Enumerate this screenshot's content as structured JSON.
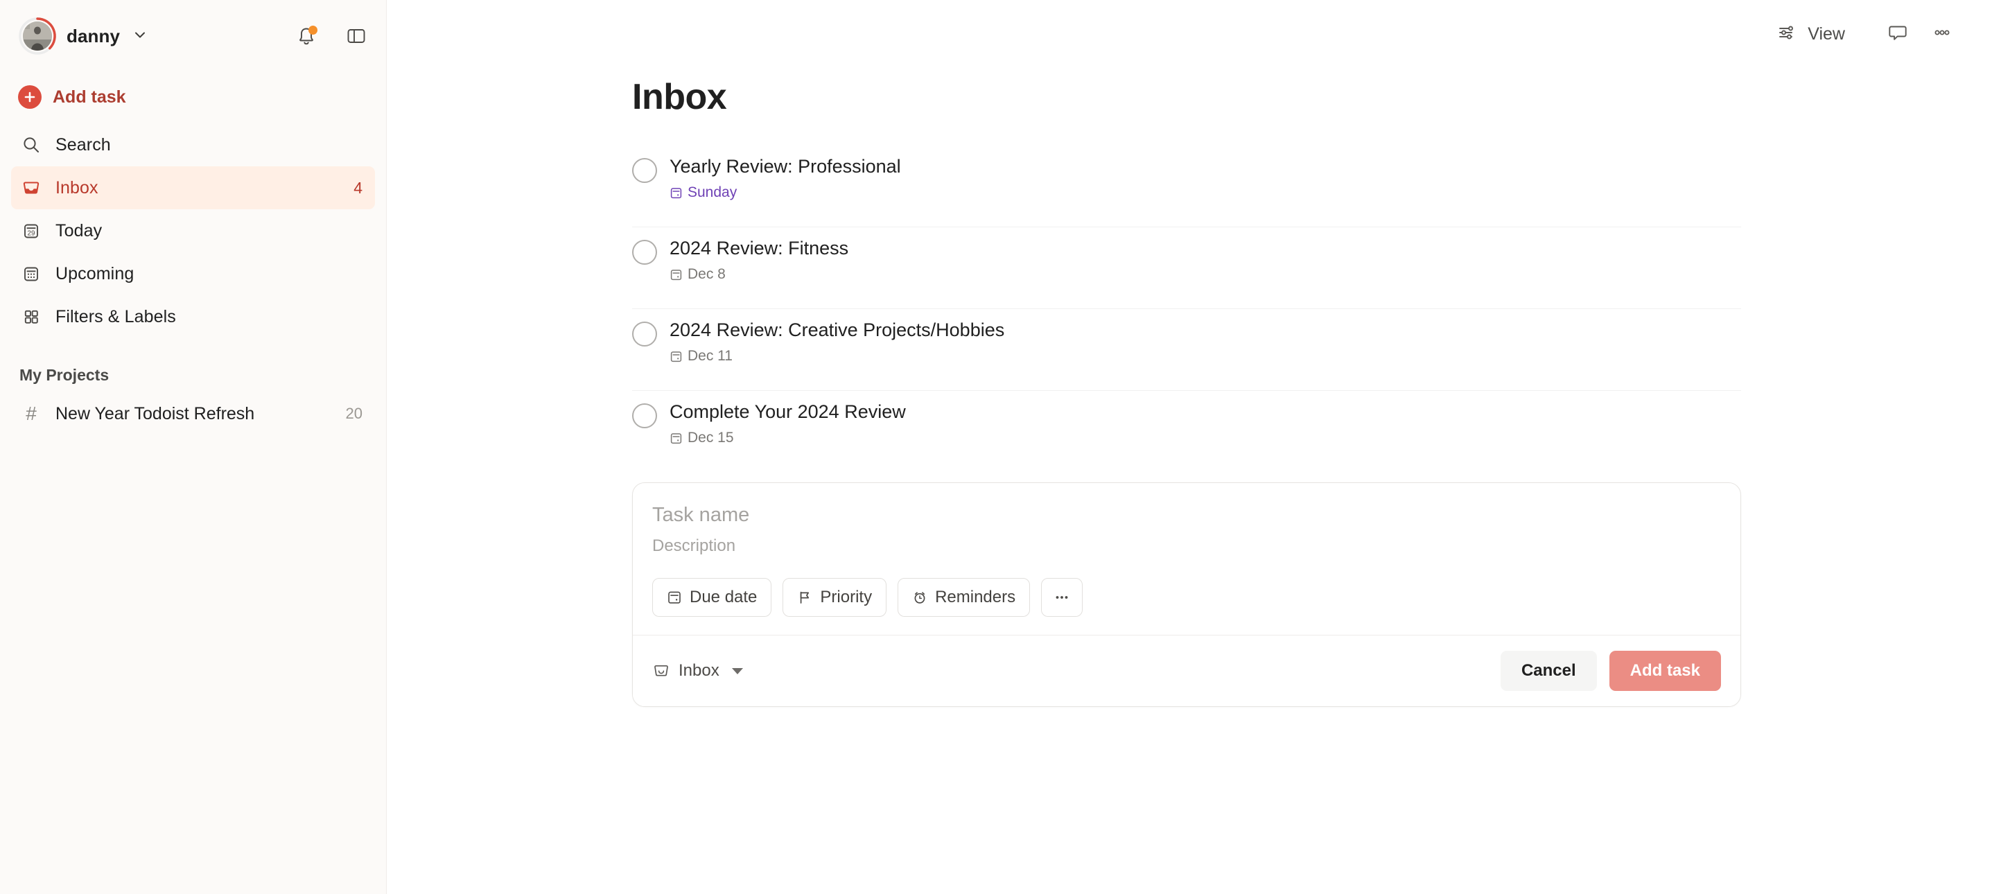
{
  "sidebar": {
    "user": {
      "name": "danny",
      "avatar_icon": "user-avatar-photo",
      "chevron_icon": "chevron-down-icon"
    },
    "notifications": {
      "icon": "bell-icon",
      "has_badge": true,
      "badge_color": "#f5902b"
    },
    "panel_toggle": {
      "icon": "sidebar-panel-icon"
    },
    "add_task": {
      "label": "Add task",
      "icon": "plus-circle-icon"
    },
    "nav": [
      {
        "label": "Search",
        "icon": "search-icon",
        "count": "",
        "active": false
      },
      {
        "label": "Inbox",
        "icon": "inbox-tray-icon",
        "count": "4",
        "active": true
      },
      {
        "label": "Today",
        "icon": "calendar-29-icon",
        "count": "",
        "active": false
      },
      {
        "label": "Upcoming",
        "icon": "calendar-grid-icon",
        "count": "",
        "active": false
      },
      {
        "label": "Filters & Labels",
        "icon": "grid-squares-icon",
        "count": "",
        "active": false
      }
    ],
    "projects_section_title": "My Projects",
    "projects": [
      {
        "label": "New Year Todoist Refresh",
        "icon": "hash-icon",
        "count": "20"
      }
    ]
  },
  "topbar": {
    "view_label": "View",
    "view_icon": "sliders-icon",
    "comments_icon": "comment-bubble-icon",
    "more_icon": "more-horizontal-icon"
  },
  "main": {
    "page_title": "Inbox",
    "tasks": [
      {
        "title": "Yearly Review: Professional",
        "date": "Sunday",
        "date_state": "upcoming",
        "date_icon": "calendar-small-icon",
        "checkbox_icon": "checkbox-circle-icon"
      },
      {
        "title": "2024 Review: Fitness",
        "date": "Dec 8",
        "date_state": "past",
        "date_icon": "calendar-small-icon",
        "checkbox_icon": "checkbox-circle-icon"
      },
      {
        "title": "2024 Review: Creative Projects/Hobbies",
        "date": "Dec 11",
        "date_state": "past",
        "date_icon": "calendar-small-icon",
        "checkbox_icon": "checkbox-circle-icon"
      },
      {
        "title": "Complete Your 2024 Review",
        "date": "Dec 15",
        "date_state": "past",
        "date_icon": "calendar-small-icon",
        "checkbox_icon": "checkbox-circle-icon"
      }
    ],
    "composer": {
      "task_name_placeholder": "Task name",
      "description_placeholder": "Description",
      "task_name_value": "",
      "description_value": "",
      "chips": [
        {
          "label": "Due date",
          "icon": "calendar-small-icon"
        },
        {
          "label": "Priority",
          "icon": "flag-icon"
        },
        {
          "label": "Reminders",
          "icon": "alarm-clock-icon"
        },
        {
          "label": "",
          "icon": "more-horizontal-icon"
        }
      ],
      "project_selector": {
        "label": "Inbox",
        "icon": "inbox-outline-icon",
        "caret_icon": "caret-down-icon"
      },
      "cancel_label": "Cancel",
      "submit_label": "Add task"
    }
  },
  "colors": {
    "accent_red": "#dc4c3e",
    "add_task_text": "#ac3d30",
    "active_nav_bg": "#ffefe5",
    "active_nav_text": "#b8392b",
    "upcoming_date": "#6f42b5",
    "past_date": "#7a7875",
    "submit_disabled": "#eb8d84",
    "badge_orange": "#f5902b",
    "sidebar_bg": "#fcfaf8"
  }
}
